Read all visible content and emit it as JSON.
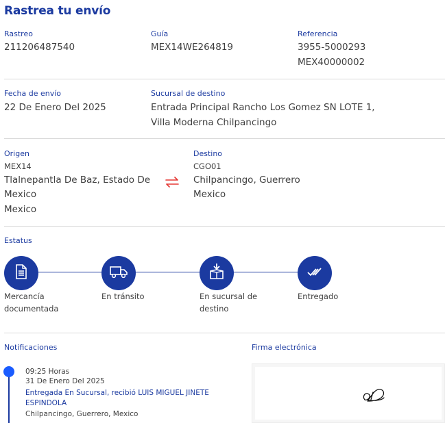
{
  "header": {
    "title": "Rastrea tu envío"
  },
  "shipment": {
    "rastreo_label": "Rastreo",
    "rastreo_value": "211206487540",
    "guia_label": "Guía",
    "guia_value": "MEX14WE264819",
    "referencia_label": "Referencia",
    "referencia_values": [
      "3955-5000293",
      "MEX40000002"
    ],
    "fecha_label": "Fecha de envío",
    "fecha_value": "22 De Enero Del 2025",
    "sucursal_label": "Sucursal de destino",
    "sucursal_lines": [
      "Entrada Principal Rancho Los Gomez SN LOTE 1,",
      "Villa Moderna Chilpancingo"
    ]
  },
  "route": {
    "origen_label": "Origen",
    "origen_code": "MEX14",
    "origen_lines": [
      "Tlalnepantla De Baz, Estado De",
      "Mexico",
      "Mexico"
    ],
    "destino_label": "Destino",
    "destino_code": "CGO01",
    "destino_lines": [
      "Chilpancingo, Guerrero",
      "Mexico"
    ],
    "swap_icon": "arrows-swap-icon",
    "swap_color": "#e53935"
  },
  "status": {
    "label": "Estatus",
    "steps": [
      {
        "icon": "document-icon",
        "label_lines": [
          "Mercancía",
          "documentada"
        ]
      },
      {
        "icon": "truck-icon",
        "label_lines": [
          "En tránsito"
        ]
      },
      {
        "icon": "box-arrow-icon",
        "label_lines": [
          "En sucursal de",
          "destino"
        ]
      },
      {
        "icon": "double-check-icon",
        "label_lines": [
          "Entregado"
        ]
      }
    ],
    "accent": "#1b3aa0"
  },
  "notifications": {
    "label": "Notificaciones",
    "items": [
      {
        "time": "09:25 Horas",
        "date": "31 De Enero Del 2025",
        "message_lines": [
          "Entregada En Sucursal, recibió LUIS MIGUEL JINETE",
          "ESPINDOLA"
        ],
        "place": "Chilpancingo, Guerrero, Mexico"
      }
    ]
  },
  "signature": {
    "label": "Firma electrónica"
  }
}
